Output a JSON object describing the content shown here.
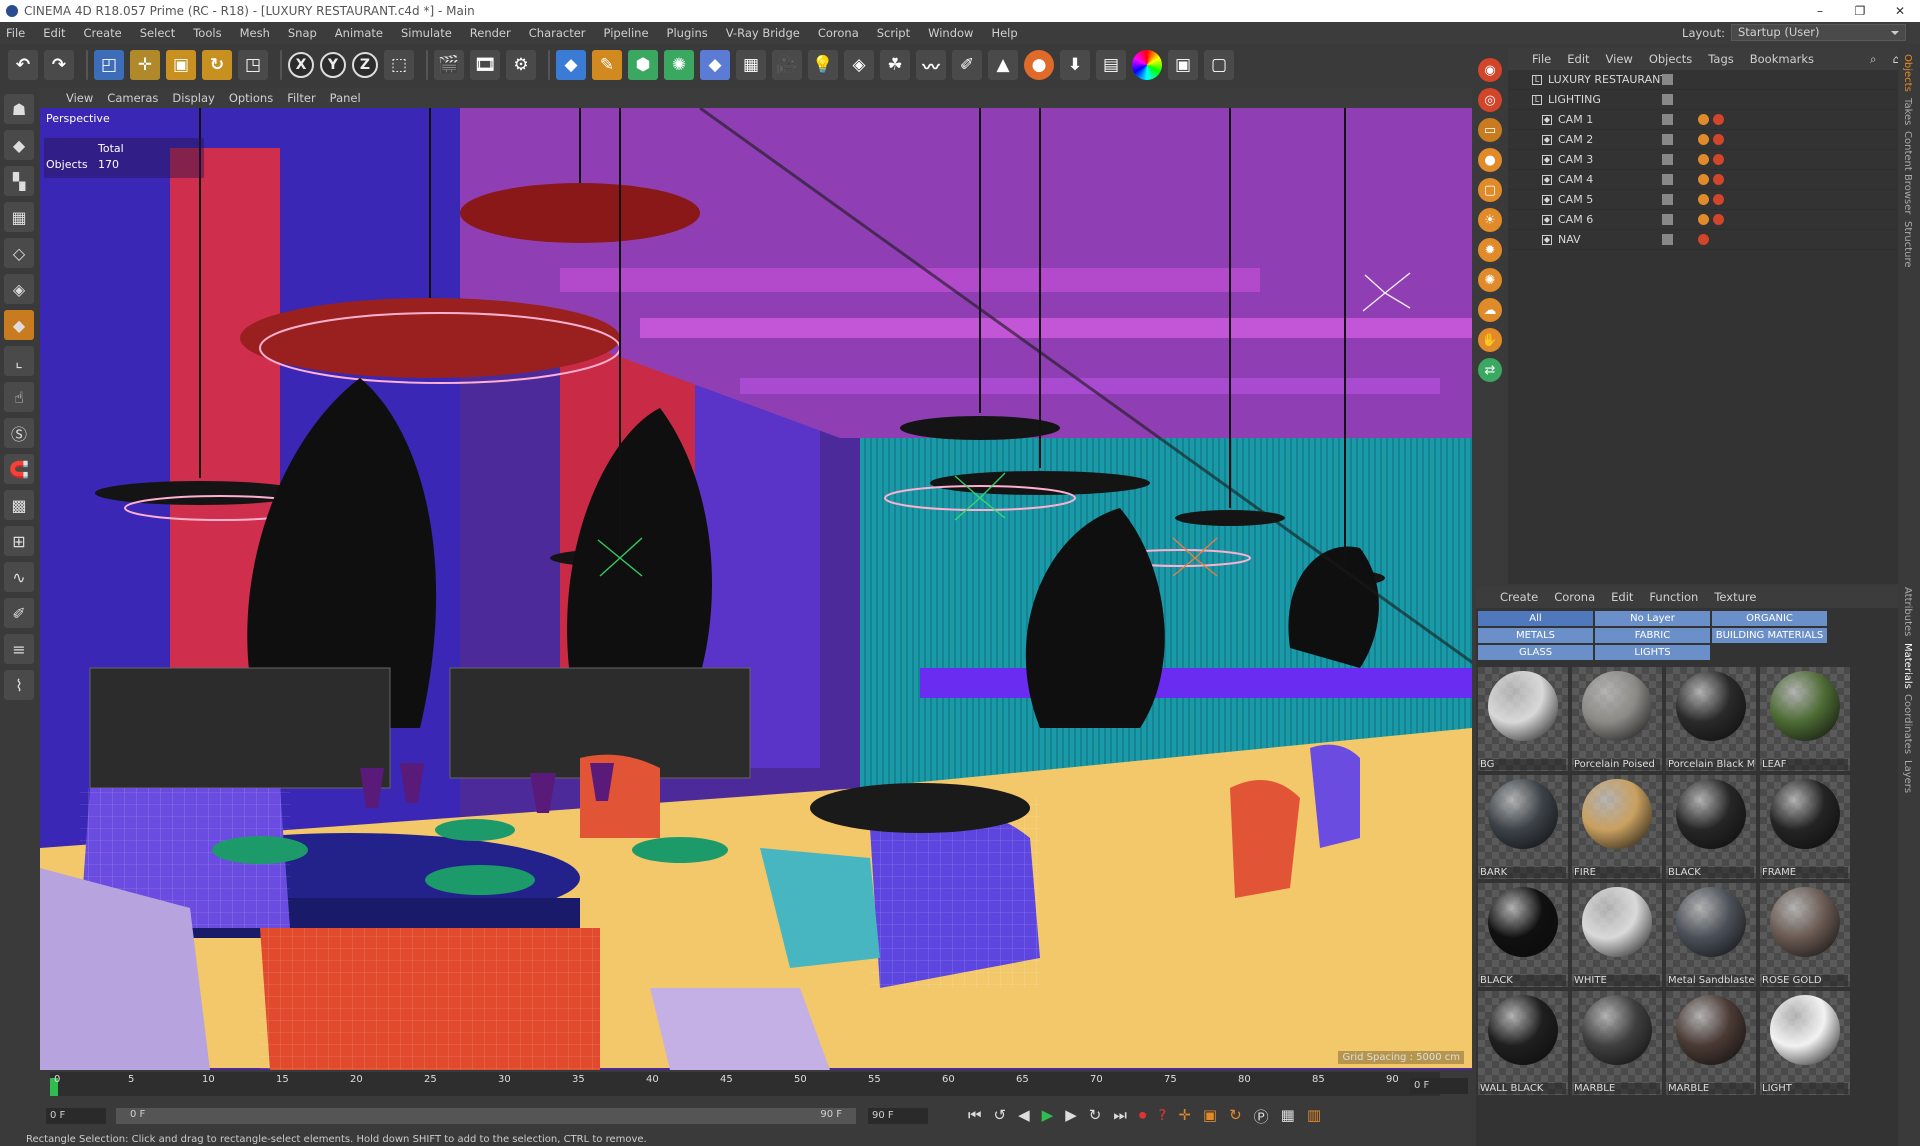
{
  "window": {
    "title": "CINEMA 4D R18.057 Prime (RC - R18) - [LUXURY RESTAURANT.c4d *] - Main",
    "controls": [
      "–",
      "❐",
      "✕"
    ]
  },
  "menu": [
    "File",
    "Edit",
    "Create",
    "Select",
    "Tools",
    "Mesh",
    "Snap",
    "Animate",
    "Simulate",
    "Render",
    "Character",
    "Pipeline",
    "Plugins",
    "V-Ray Bridge",
    "Corona",
    "Script",
    "Window",
    "Help"
  ],
  "layout": {
    "label": "Layout:",
    "value": "Startup (User)"
  },
  "toolbar": {
    "axes": [
      "X",
      "Y",
      "Z"
    ]
  },
  "viewport": {
    "menu": [
      "View",
      "Cameras",
      "Display",
      "Options",
      "Filter",
      "Panel"
    ],
    "name": "Perspective",
    "stats_header": "Total",
    "stats_label": "Objects",
    "stats_value": "170",
    "grid_spacing": "Grid Spacing : 5000 cm"
  },
  "timeline": {
    "ticks": [
      "0",
      "5",
      "10",
      "15",
      "20",
      "25",
      "30",
      "35",
      "40",
      "45",
      "50",
      "55",
      "60",
      "65",
      "70",
      "75",
      "80",
      "85",
      "90"
    ],
    "current": "0 F",
    "start": "0 F",
    "range_start": "0 F",
    "range_end": "90 F",
    "end": "90 F"
  },
  "status": "Rectangle Selection: Click and drag to rectangle-select elements. Hold down SHIFT to add to the selection, CTRL to remove.",
  "objects": {
    "menu": [
      "File",
      "Edit",
      "View",
      "Objects",
      "Tags",
      "Bookmarks"
    ],
    "rows": [
      {
        "name": "LUXURY RESTAURANT",
        "indent": 0
      },
      {
        "name": "LIGHTING",
        "indent": 0
      },
      {
        "name": "CAM 1",
        "indent": 1
      },
      {
        "name": "CAM 2",
        "indent": 1
      },
      {
        "name": "CAM 3",
        "indent": 1
      },
      {
        "name": "CAM 4",
        "indent": 1
      },
      {
        "name": "CAM 5",
        "indent": 1
      },
      {
        "name": "CAM 6",
        "indent": 1
      },
      {
        "name": "NAV",
        "indent": 1
      }
    ]
  },
  "right_tabs": [
    "Objects",
    "Takes",
    "Content Browser",
    "Structure",
    "Attributes",
    "Materials",
    "Coordinates",
    "Layers"
  ],
  "materials": {
    "menu": [
      "Create",
      "Corona",
      "Edit",
      "Function",
      "Texture"
    ],
    "tabs": [
      "All",
      "No Layer",
      "ORGANIC",
      "METALS",
      "FABRIC",
      "BUILDING MATERIALS",
      "GLASS",
      "LIGHTS"
    ],
    "items": [
      {
        "name": "BG",
        "color": "#d8d8d8"
      },
      {
        "name": "Porcelain Poised",
        "color": "#8c8a86"
      },
      {
        "name": "Porcelain Black M",
        "color": "#2a2a2a"
      },
      {
        "name": "LEAF",
        "color": "#4d6b34"
      },
      {
        "name": "BARK",
        "color": "#3c4248"
      },
      {
        "name": "FIRE",
        "color": "#c9a060"
      },
      {
        "name": "BLACK",
        "color": "#262626"
      },
      {
        "name": "FRAME",
        "color": "#242424"
      },
      {
        "name": "BLACK",
        "color": "#101010"
      },
      {
        "name": "WHITE",
        "color": "#d9d9d9"
      },
      {
        "name": "Metal Sandblaste",
        "color": "#4b5058"
      },
      {
        "name": "ROSE GOLD",
        "color": "#6a5a52"
      },
      {
        "name": "WALL BLACK",
        "color": "#1f1f1f"
      },
      {
        "name": "MARBLE",
        "color": "#3f3f3f"
      },
      {
        "name": "MARBLE",
        "color": "#4a3a34"
      },
      {
        "name": "LIGHT",
        "color": "#f2f2f2"
      }
    ]
  },
  "colors": {
    "accent": "#4f78bd",
    "viewport_bg": "#5a2fa0"
  }
}
